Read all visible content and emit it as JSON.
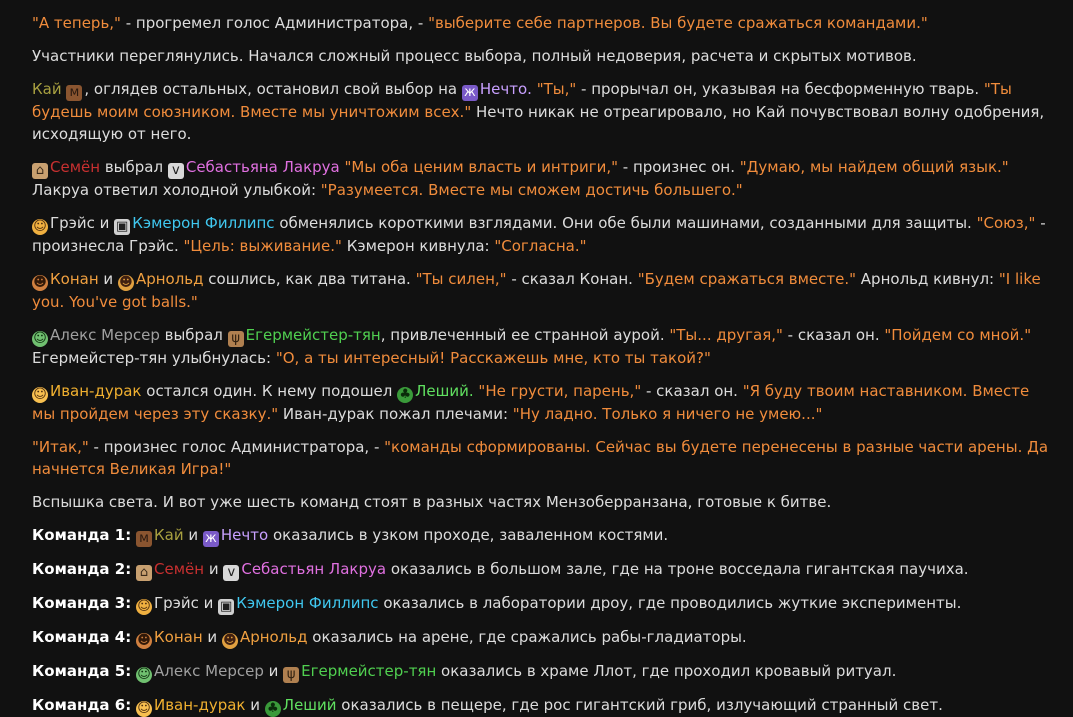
{
  "colors": {
    "background": "#111111",
    "text": "#dcdcdc",
    "quote": "#f08c3c"
  },
  "p1": {
    "q1": "\"А теперь,\"",
    "t1": " - прогремел голос Администратора, - ",
    "q2": "\"выберите себе партнеров. Вы будете сражаться командами.\""
  },
  "p2": {
    "t1": "Участники переглянулись. Начался сложный процесс выбора, полный недоверия, расчета и скрытых мотивов."
  },
  "p3": {
    "kai": "Кай",
    "t1": ", оглядев остальных, остановил свой выбор на ",
    "nechto": "Нечто.",
    "q1": " \"Ты,\"",
    "t2": " - прорычал он, указывая на бесформенную тварь. ",
    "q2": "\"Ты будешь моим союзником. Вместе мы уничтожим всех.\"",
    "t3": " Нечто никак не отреагировало, но Кай почувствовал волну одобрения, исходящую от него."
  },
  "p4": {
    "semen": "Семён",
    "t1": " выбрал ",
    "seb": "Себастьяна Лакруа",
    "q1": " \"Мы оба ценим власть и интриги,\"",
    "t2": " - произнес он. ",
    "q2": "\"Думаю, мы найдем общий язык.\"",
    "t3": " Лакруа ответил холодной улыбкой: ",
    "q3": "\"Разумеется. Вместе мы сможем достичь большего.\""
  },
  "p5": {
    "grace": "Грэйс",
    "t1": " и ",
    "cam": "Кэмерон Филлипс",
    "t2": " обменялись короткими взглядами. Они обе были машинами, созданными для защиты. ",
    "q1": "\"Союз,\"",
    "t3": " - произнесла Грэйс. ",
    "q2": "\"Цель: выживание.\"",
    "t4": " Кэмерон кивнула: ",
    "q3": "\"Согласна.\""
  },
  "p6": {
    "conan": "Конан",
    "t1": " и ",
    "arnold": "Арнольд",
    "t2": " сошлись, как два титана. ",
    "q1": "\"Ты силен,\"",
    "t3": " - сказал Конан. ",
    "q2": "\"Будем сражаться вместе.\"",
    "t4": " Арнольд кивнул: ",
    "q3": "\"I like you. You've got balls.\""
  },
  "p7": {
    "alex": "Алекс Мерсер",
    "t1": " выбрал ",
    "eger": "Егермейстер-тян",
    "t2": ", привлеченный ее странной аурой. ",
    "q1": "\"Ты... другая,\"",
    "t3": " - сказал он. ",
    "q2": "\"Пойдем со мной.\"",
    "t4": " Егермейстер-тян улыбнулась: ",
    "q3": "\"О, а ты интересный! Расскажешь мне, кто ты такой?\""
  },
  "p8": {
    "ivan": "Иван-дурак",
    "t1": " остался один. К нему подошел ",
    "leshy": "Леший.",
    "q1": " \"Не грусти, парень,\"",
    "t2": " - сказал он. ",
    "q2": "\"Я буду твоим наставником. Вместе мы пройдем через эту сказку.\"",
    "t3": " Иван-дурак пожал плечами: ",
    "q3": "\"Ну ладно. Только я ничего не умею...\""
  },
  "p9": {
    "q1": "\"Итак,\"",
    "t1": " - произнес голос Администратора, - ",
    "q2": "\"команды сформированы. Сейчас вы будете перенесены в разные части арены. Да начнется Великая Игра!\""
  },
  "p10": {
    "t1": "Вспышка света. И вот уже шесть команд стоят в разных частях Мензоберранзана, готовые к битве."
  },
  "teams": [
    {
      "label": "Команда 1:",
      "a": "Кай",
      "and": " и ",
      "b": "Нечто",
      "rest": " оказались в узком проходе, заваленном костями."
    },
    {
      "label": "Команда 2:",
      "a": "Семён",
      "and": " и ",
      "b": "Себастьян Лакруа",
      "rest": " оказались в большом зале, где на троне восседала гигантская паучиха."
    },
    {
      "label": "Команда 3:",
      "a": "Грэйс",
      "and": " и ",
      "b": "Кэмерон Филлипс",
      "rest": " оказались в лаборатории дроу, где проводились жуткие эксперименты."
    },
    {
      "label": "Команда 4:",
      "a": "Конан",
      "and": " и ",
      "b": "Арнольд",
      "rest": " оказались на арене, где сражались рабы-гладиаторы."
    },
    {
      "label": "Команда 5:",
      "a": "Алекс Мерсер",
      "and": " и ",
      "b": "Егермейстер-тян",
      "rest": " оказались в храме Ллот, где проходил кровавый ритуал."
    },
    {
      "label": "Команда 6:",
      "a": "Иван-дурак",
      "and": " и ",
      "b": "Леший",
      "rest": " оказались в пещере, где рос гигантский гриб, излучающий странный свет."
    }
  ],
  "icons": {
    "kai": "mammoth-icon",
    "nechto": "alien-monster-icon",
    "semen": "house-icon",
    "seb": "vampire-icon",
    "grace": "woman-icon",
    "cam": "robot-icon",
    "conan": "barbarian-icon",
    "arnold": "cowboy-icon",
    "alex": "alien-face-icon",
    "eger": "goat-icon",
    "ivan": "baby-face-icon",
    "leshy": "tree-icon"
  }
}
